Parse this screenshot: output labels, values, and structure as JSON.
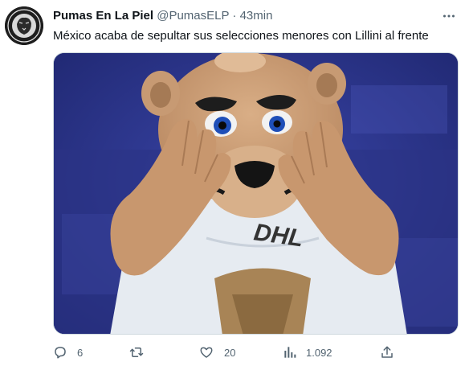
{
  "tweet": {
    "author_name": "Pumas En La Piel",
    "handle": "@PumasELP",
    "separator": "·",
    "time": "43min",
    "text": "México acaba de sepultar sus selecciones menores con Lillini al frente",
    "more_icon": "more-horizontal-icon",
    "media_description_icon": "pumas-mascot-photo",
    "avatar_icon": "pumas-logo-avatar"
  },
  "actions": {
    "reply": {
      "icon": "reply-icon",
      "count": "6"
    },
    "retweet": {
      "icon": "retweet-icon",
      "count": ""
    },
    "like": {
      "icon": "heart-icon",
      "count": "20"
    },
    "views": {
      "icon": "views-icon",
      "count": "1.092"
    },
    "share": {
      "icon": "share-icon"
    }
  },
  "colors": {
    "text_primary": "#0f1419",
    "text_secondary": "#536471",
    "media_background": "#2a3384",
    "jersey": "#e9eef3",
    "costume": "#c89a72"
  }
}
